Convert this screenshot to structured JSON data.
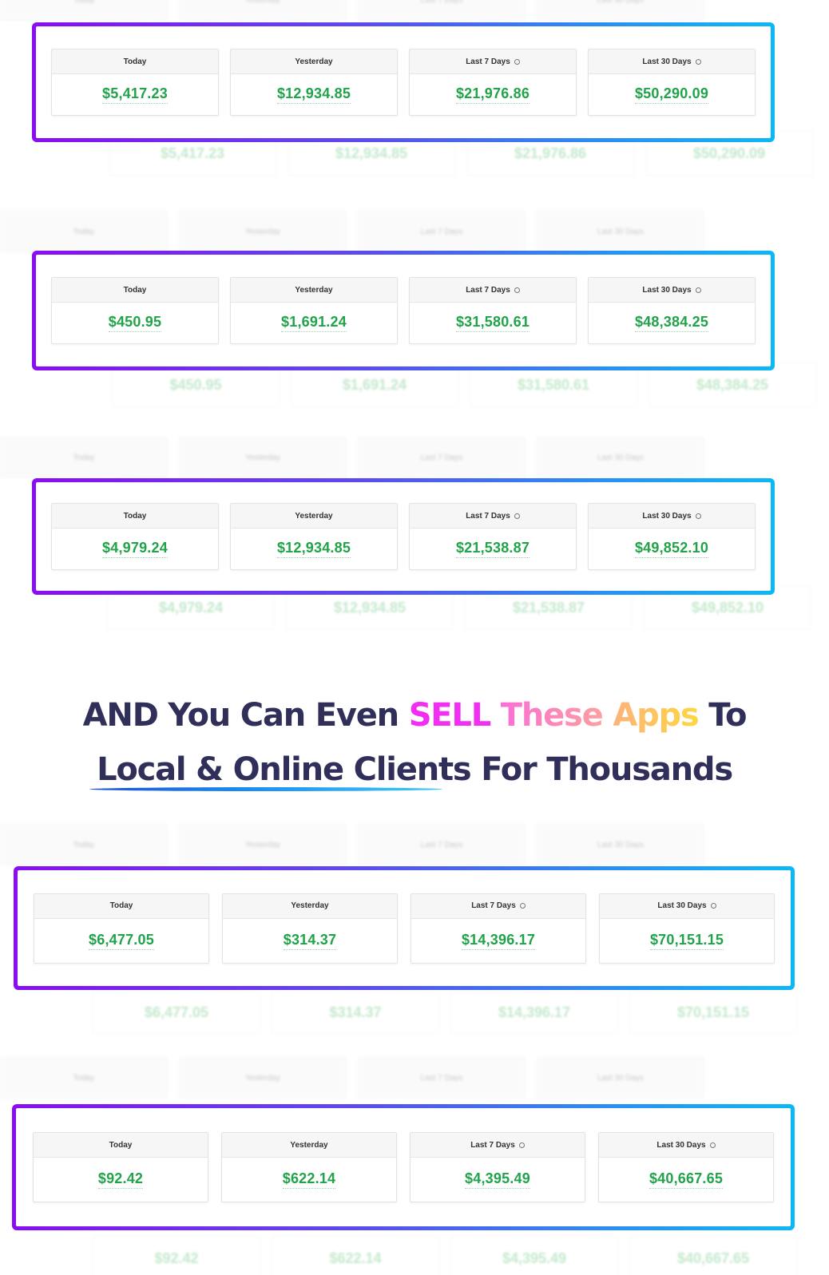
{
  "labels": {
    "today": "Today",
    "yesterday": "Yesterday",
    "last7": "Last 7 Days",
    "last30": "Last 30 Days"
  },
  "panels": [
    {
      "today": "$5,417.23",
      "yesterday": "$12,934.85",
      "last7": "$21,976.86",
      "last30": "$50,290.09"
    },
    {
      "today": "$450.95",
      "yesterday": "$1,691.24",
      "last7": "$31,580.61",
      "last30": "$48,384.25"
    },
    {
      "today": "$4,979.24",
      "yesterday": "$12,934.85",
      "last7": "$21,538.87",
      "last30": "$49,852.10"
    },
    {
      "today": "$6,477.05",
      "yesterday": "$314.37",
      "last7": "$14,396.17",
      "last30": "$70,151.15"
    },
    {
      "today": "$92.42",
      "yesterday": "$622.14",
      "last7": "$4,395.49",
      "last30": "$40,667.65"
    }
  ],
  "headline": {
    "line1_start": "AND You Can Even ",
    "sell": "SELL",
    "these": "These",
    "apps": "Apps",
    "line1_end": " To",
    "line2": "Local & Online Clients For Thousands"
  },
  "colors": {
    "amount_green": "#21a34a",
    "headline_navy": "#2f2f5a",
    "frame_start": "#8a0cf3",
    "frame_end": "#0cb8f5"
  }
}
